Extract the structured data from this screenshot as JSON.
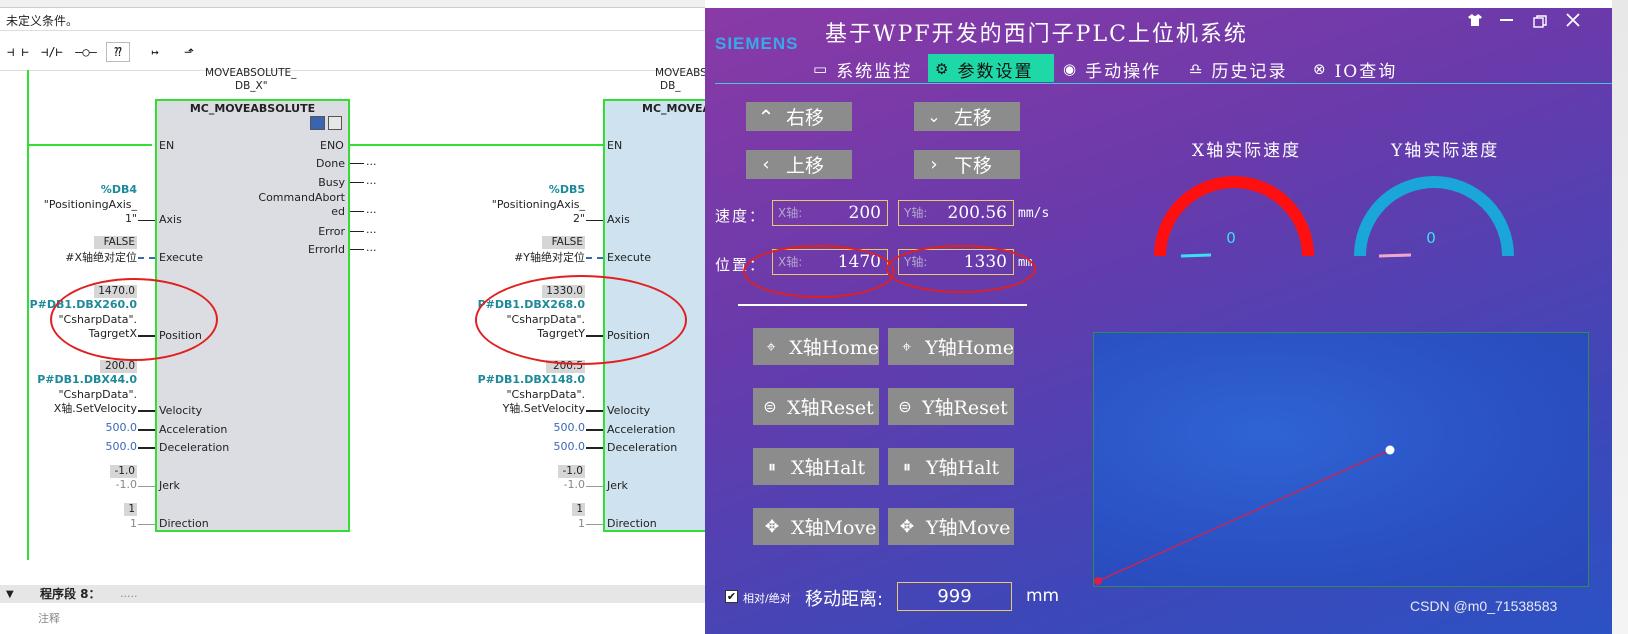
{
  "tia": {
    "condition_text": "未定义条件。",
    "toolbar": [
      "⊣ ⊢",
      "⊣/⊢",
      "–○–",
      "⁇",
      "↦",
      "⬏"
    ],
    "db_left": "MOVEABSOLUTE_",
    "db_left2": "DB_X\"",
    "db_right": "MOVEABSOLUTE_",
    "db_right2": "DB_",
    "block_title": "MC_MOVEABSOLUTE",
    "block_title_right": "MC_MOVEA",
    "en": "EN",
    "eno": "ENO",
    "outputs": [
      "Done",
      "Busy",
      "CommandAbort",
      "ed",
      "Error",
      "ErrorId"
    ],
    "output_vals": [
      "...",
      "...",
      "...",
      "...",
      "..."
    ],
    "inputs": [
      "Axis",
      "Execute",
      "Position",
      "Velocity",
      "Acceleration",
      "Deceleration",
      "Jerk",
      "Direction"
    ],
    "left_params": {
      "axis_addr": "%DB4",
      "axis_name": "\"PositioningAxis_",
      "axis_name2": "1\"",
      "exec_val": "FALSE",
      "exec_name": "#X轴绝对定位",
      "pos_val": "1470.0",
      "pos_addr": "P#DB1.DBX260.0",
      "pos_name": "\"CsharpData\".",
      "pos_name2": "TagrgetX",
      "vel_val": "200.0",
      "vel_addr": "P#DB1.DBX44.0",
      "vel_name": "\"CsharpData\".",
      "vel_name2": "X轴.SetVelocity",
      "acc": "500.0",
      "dec": "500.0",
      "jerk_val": "-1.0",
      "jerk_name": "-1.0",
      "dir_val": "1",
      "dir_name": "1"
    },
    "right_params": {
      "axis_addr": "%DB5",
      "axis_name": "\"PositioningAxis_",
      "axis_name2": "2\"",
      "exec_val": "FALSE",
      "exec_name": "#Y轴绝对定位",
      "pos_val": "1330.0",
      "pos_addr": "P#DB1.DBX268.0",
      "pos_name": "\"CsharpData\".",
      "pos_name2": "TagrgetY",
      "vel_val": "200.5",
      "vel_addr": "P#DB1.DBX148.0",
      "vel_name": "\"CsharpData\".",
      "vel_name2": "Y轴.SetVelocity",
      "acc": "500.0",
      "dec": "500.0",
      "jerk_val": "-1.0",
      "jerk_name": "-1.0",
      "dir_val": "1",
      "dir_name": "1"
    },
    "segment_label": "程序段 8：",
    "segment_dots": ".....",
    "comment_label": "注释"
  },
  "app": {
    "brand": "SIEMENS",
    "title": "基于WPF开发的西门子PLC上位机系统",
    "window_icons": [
      "shirt-icon",
      "minimize-icon",
      "restore-icon",
      "close-icon"
    ],
    "nav": [
      {
        "icon": "monitor-icon",
        "glyph": "🖵",
        "label": "系统监控"
      },
      {
        "icon": "gear-icon",
        "glyph": "⚙",
        "label": "参数设置"
      },
      {
        "icon": "hand-icon",
        "glyph": "☝",
        "label": "手动操作"
      },
      {
        "icon": "bell-icon",
        "glyph": "🔔",
        "label": "历史记录"
      },
      {
        "icon": "io-icon",
        "glyph": "⊛",
        "label": "IO查询"
      }
    ],
    "active_tab": 1,
    "jog": {
      "right": "右移",
      "left": "左移",
      "up": "上移",
      "down": "下移"
    },
    "speed_label": "速度：",
    "position_label": "位置：",
    "x_placeholder": "X轴:",
    "y_placeholder": "Y轴:",
    "speed_x": "200",
    "speed_y": "200.56",
    "speed_unit": "mm/s",
    "pos_x": "1470",
    "pos_y": "1330",
    "pos_unit": "mm",
    "buttons": {
      "x_home": "X轴Home",
      "y_home": "Y轴Home",
      "x_reset": "X轴Reset",
      "y_reset": "Y轴Reset",
      "x_halt": "X轴Halt",
      "y_halt": "Y轴Halt",
      "x_move": "X轴Move",
      "y_move": "Y轴Move"
    },
    "gauge_x_title": "X轴实际速度",
    "gauge_y_title": "Y轴实际速度",
    "gauge_x_value": "0",
    "gauge_y_value": "0",
    "gauge_x_color": "#ff1010",
    "gauge_y_color": "#1aa6d8",
    "checkbox_label": "相对/绝对",
    "checkbox_checked": true,
    "move_dist_label": "移动距离:",
    "move_dist_value": "999",
    "move_dist_unit": "mm",
    "plot": {
      "line_color": "#d8204a",
      "point_color": "#ffffff"
    },
    "watermark": "CSDN @m0_71538583"
  }
}
